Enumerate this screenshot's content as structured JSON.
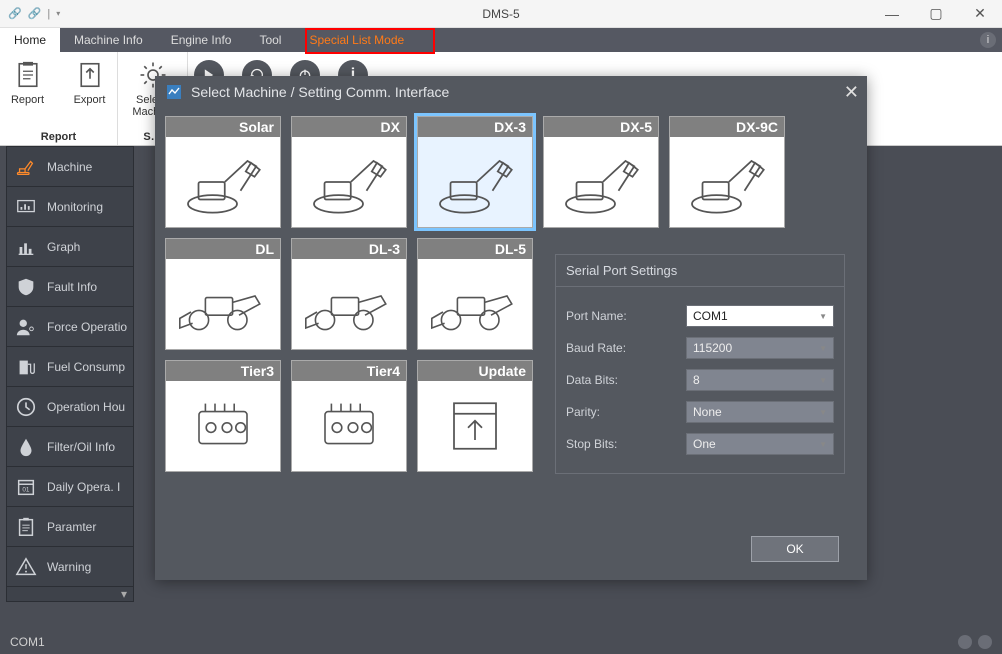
{
  "titlebar": {
    "title": "DMS-5"
  },
  "ribbon_tabs": {
    "items": [
      {
        "label": "Home"
      },
      {
        "label": "Machine Info"
      },
      {
        "label": "Engine Info"
      },
      {
        "label": "Tool"
      },
      {
        "label": "Special List Mode"
      }
    ]
  },
  "ribbon": {
    "group_report_title": "Report",
    "report": "Report",
    "export": "Export",
    "select_machine": "Sele…\nMachi…",
    "group2_title": "S…"
  },
  "sidebar": {
    "items": [
      {
        "label": "Machine"
      },
      {
        "label": "Monitoring"
      },
      {
        "label": "Graph"
      },
      {
        "label": "Fault Info"
      },
      {
        "label": "Force Operatio"
      },
      {
        "label": "Fuel Consump"
      },
      {
        "label": "Operation Hou"
      },
      {
        "label": "Filter/Oil Info"
      },
      {
        "label": "Daily Opera. I"
      },
      {
        "label": "Paramter"
      },
      {
        "label": "Warning"
      }
    ]
  },
  "statusbar": {
    "port": "COM1"
  },
  "modal": {
    "title": "Select Machine / Setting Comm. Interface",
    "tiles": [
      {
        "label": "Solar",
        "type": "excavator"
      },
      {
        "label": "DX",
        "type": "excavator"
      },
      {
        "label": "DX-3",
        "type": "excavator",
        "selected": true
      },
      {
        "label": "DX-5",
        "type": "excavator"
      },
      {
        "label": "DX-9C",
        "type": "excavator"
      },
      {
        "label": "DL",
        "type": "loader"
      },
      {
        "label": "DL-3",
        "type": "loader"
      },
      {
        "label": "DL-5",
        "type": "loader"
      },
      {
        "label": "Tier3",
        "type": "engine"
      },
      {
        "label": "Tier4",
        "type": "engine"
      },
      {
        "label": "Update",
        "type": "update"
      }
    ],
    "settings": {
      "title": "Serial Port Settings",
      "rows": {
        "port_name_label": "Port Name:",
        "port_name_value": "COM1",
        "baud_label": "Baud Rate:",
        "baud_value": "115200",
        "databits_label": "Data Bits:",
        "databits_value": "8",
        "parity_label": "Parity:",
        "parity_value": "None",
        "stopbits_label": "Stop Bits:",
        "stopbits_value": "One"
      }
    },
    "ok": "OK"
  }
}
